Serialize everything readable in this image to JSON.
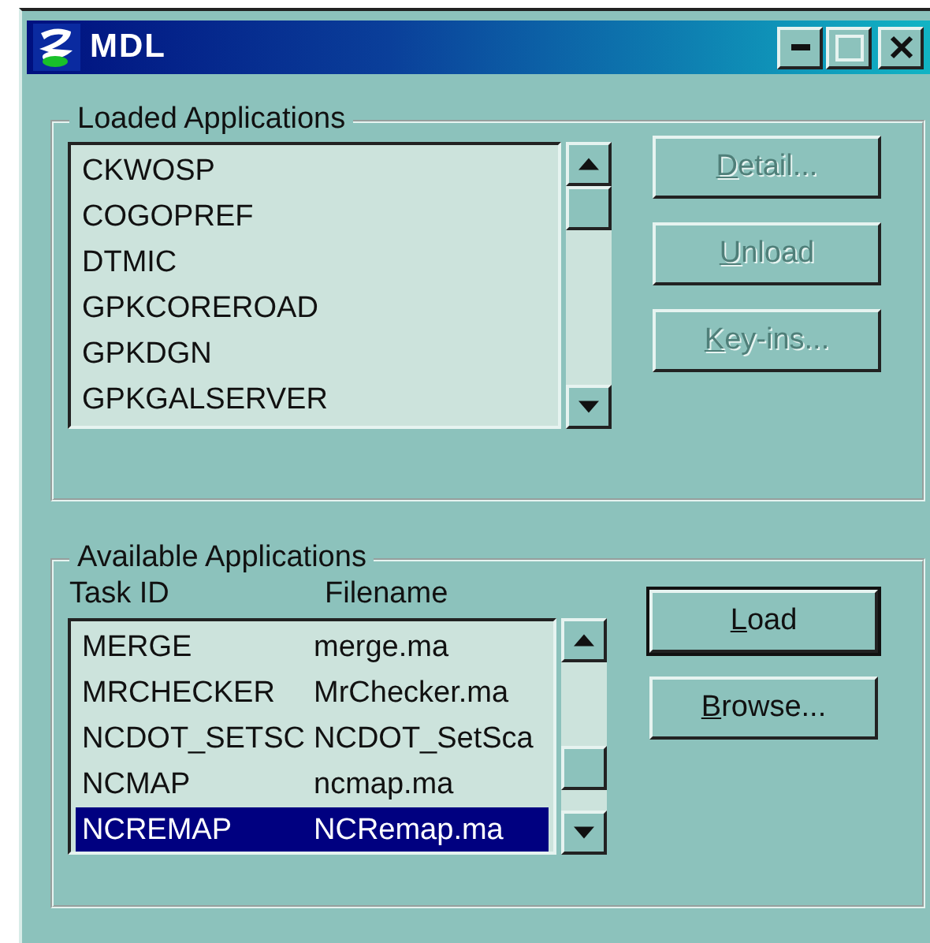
{
  "window": {
    "title": "MDL"
  },
  "loaded_applications": {
    "title": "Loaded Applications",
    "items": [
      {
        "name": "CKWOSP",
        "selected": false
      },
      {
        "name": "COGOPREF",
        "selected": false
      },
      {
        "name": "DTMIC",
        "selected": false
      },
      {
        "name": "GPKCOREROAD",
        "selected": false
      },
      {
        "name": "GPKDGN",
        "selected": false
      },
      {
        "name": "GPKGALSERVER",
        "selected": false
      }
    ],
    "buttons": [
      {
        "label": "Detail...",
        "disabled": true
      },
      {
        "label": "Unload",
        "disabled": true
      },
      {
        "label": "Key-ins...",
        "disabled": true
      }
    ]
  },
  "available_applications": {
    "title": "Available Applications",
    "columns": [
      "Task ID",
      "Filename"
    ],
    "rows": [
      {
        "task_id": "MERGE",
        "filename": "merge.ma",
        "selected": false
      },
      {
        "task_id": "MRCHECKER",
        "filename": "MrChecker.ma",
        "selected": false
      },
      {
        "task_id": "NCDOT_SETSC",
        "filename": "NCDOT_SetSca",
        "selected": false
      },
      {
        "task_id": "NCMAP",
        "filename": "ncmap.ma",
        "selected": false
      },
      {
        "task_id": "NCREMAP",
        "filename": "NCRemap.ma",
        "selected": true
      }
    ],
    "buttons": [
      {
        "label": "Load",
        "disabled": false,
        "default": true
      },
      {
        "label": "Browse...",
        "disabled": false,
        "default": false
      }
    ]
  }
}
